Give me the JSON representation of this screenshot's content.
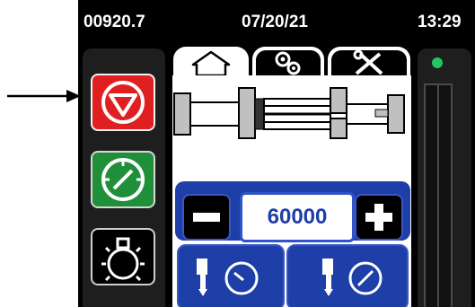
{
  "status_bar": {
    "counter": "00920.7",
    "date": "07/20/21",
    "time": "13:29"
  },
  "tabs": [
    {
      "icon": "home-icon",
      "active": true
    },
    {
      "icon": "gears-icon",
      "active": false
    },
    {
      "icon": "tools-icon",
      "active": false
    }
  ],
  "left_buttons": [
    {
      "icon": "stop-icon",
      "color": "#e02020"
    },
    {
      "icon": "gauge-icon",
      "color": "#1f8f3a"
    },
    {
      "icon": "lamp-icon",
      "color": "#000000"
    }
  ],
  "stepper": {
    "value": "60000"
  },
  "bottom_buttons": [
    {
      "icon": "cylinder-gauge-icon"
    },
    {
      "icon": "cylinder-gauge-icon"
    }
  ],
  "indicator": {
    "color": "#22c55e"
  },
  "colors": {
    "accent_blue": "#1e3ea8",
    "stop_red": "#e02020",
    "start_green": "#1f8f3a"
  }
}
